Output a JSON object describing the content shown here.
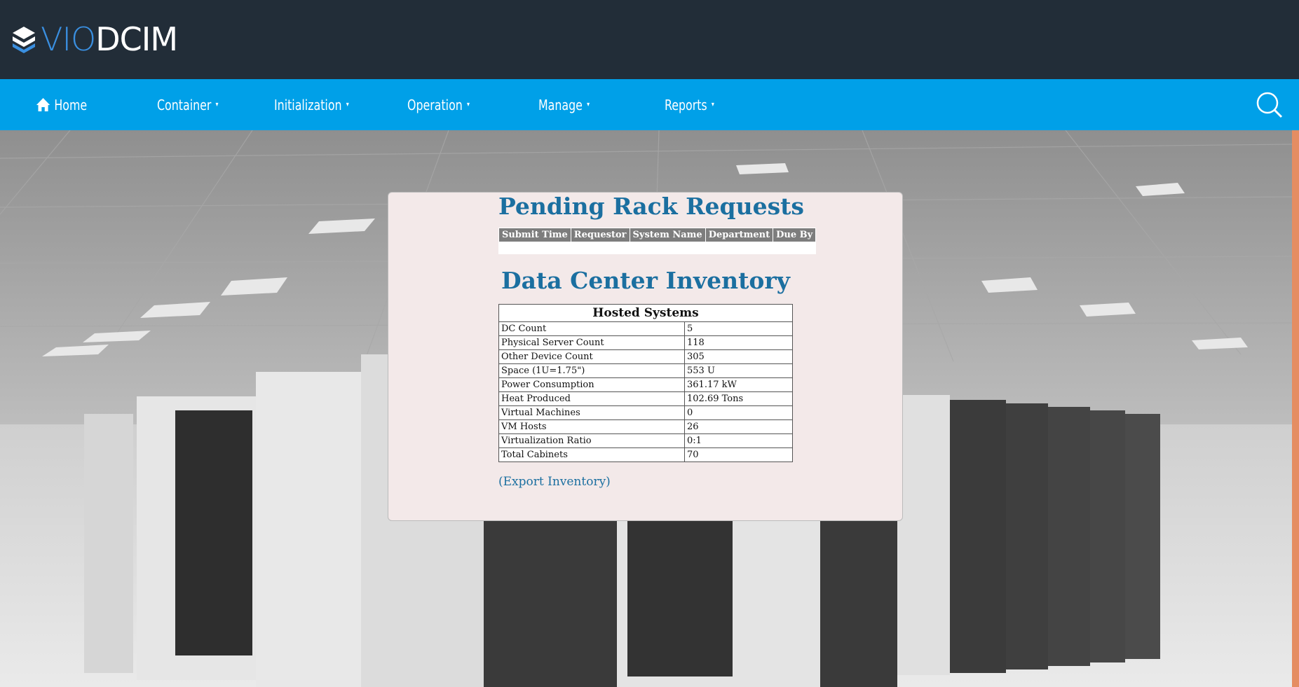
{
  "brand": {
    "logo_part1": "VIO",
    "logo_part2": "DCIM"
  },
  "nav": {
    "home": "Home",
    "items": [
      {
        "label": "Container"
      },
      {
        "label": "Initialization"
      },
      {
        "label": "Operation"
      },
      {
        "label": "Manage"
      },
      {
        "label": "Reports"
      }
    ],
    "caret": "▾"
  },
  "pending": {
    "title": "Pending Rack Requests",
    "columns": [
      "Submit Time",
      "Requestor",
      "System Name",
      "Department",
      "Due By"
    ]
  },
  "inventory": {
    "title": "Data Center Inventory",
    "table_header": "Hosted Systems",
    "rows": [
      {
        "label": "DC Count",
        "value": "5"
      },
      {
        "label": "Physical Server Count",
        "value": "118"
      },
      {
        "label": "Other Device Count",
        "value": "305"
      },
      {
        "label": "Space (1U=1.75\")",
        "value": "553 U"
      },
      {
        "label": "Power Consumption",
        "value": "361.17 kW"
      },
      {
        "label": "Heat Produced",
        "value": "102.69 Tons"
      },
      {
        "label": "Virtual Machines",
        "value": "0"
      },
      {
        "label": "VM Hosts",
        "value": "26"
      },
      {
        "label": "Virtualization Ratio",
        "value": "0:1"
      },
      {
        "label": "Total Cabinets",
        "value": "70"
      }
    ],
    "export_link": "(Export Inventory)"
  },
  "colors": {
    "topbar": "#222d38",
    "navbar": "#00a0e8",
    "heading": "#1b6fa0",
    "panel": "#f3e9e9",
    "edge": "#e58d62"
  },
  "icons": {
    "logo": "stack-layers-icon",
    "home": "home-icon",
    "search": "search-icon"
  }
}
